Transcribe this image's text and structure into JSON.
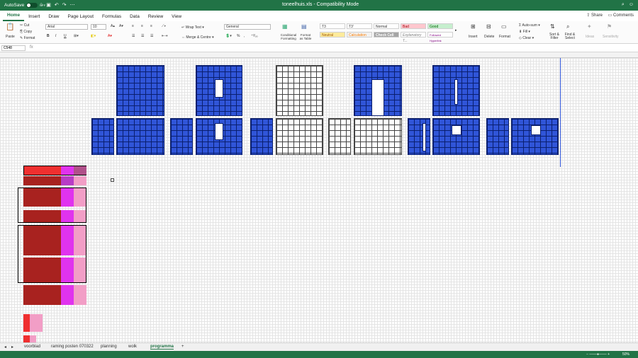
{
  "titlebar": {
    "autosave_label": "AutoSave",
    "autosave_state": "OFF",
    "document": "toneelhuis.xls  -  Compatibility Mode"
  },
  "ribbon_tabs": [
    "Home",
    "Insert",
    "Draw",
    "Page Layout",
    "Formulas",
    "Data",
    "Review",
    "View"
  ],
  "share_label": "Share",
  "comments_label": "Comments",
  "ribbon": {
    "paste": "Paste",
    "cut": "Cut",
    "copy": "Copy",
    "format_painter": "Format",
    "font_name": "Arial",
    "font_size": "10",
    "wrap_text": "Wrap Text",
    "merge_centre": "Merge & Centre",
    "number_format": "General",
    "conditional_formatting": "Conditional Formatting",
    "format_as_table": "Format as Table",
    "styles": [
      "T3",
      "T3'",
      "Normal",
      "Bad",
      "Good",
      "Neutral",
      "Calculation",
      "Check Cell",
      "Explanatory T...",
      "Followed Hyperlink"
    ],
    "insert": "Insert",
    "delete": "Delete",
    "format": "Format",
    "autosum": "Auto-sum",
    "fill": "Fill",
    "clear": "Clear",
    "sort_filter": "Sort & Filter",
    "find_select": "Find & Select",
    "ideas": "Ideas",
    "sensitivity": "Sensitivity"
  },
  "formula_bar": {
    "name_box": "C548",
    "fx": "fx"
  },
  "sheet_tabs": [
    "voorblad",
    "raming posten 070322",
    "planning",
    "wolk",
    "programma"
  ],
  "active_sheet": "programma",
  "status": {
    "zoom": "50%"
  }
}
